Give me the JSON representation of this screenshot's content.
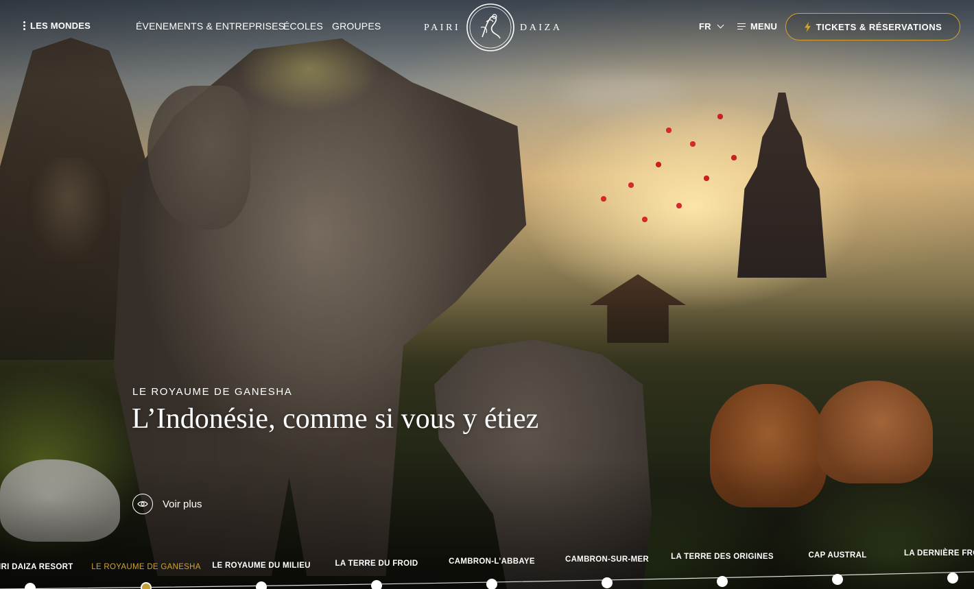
{
  "header": {
    "mondes_label": "LES MONDES",
    "nav": [
      "ÉVENEMENTS & ENTREPRISES",
      "ÉCOLES",
      "GROUPES"
    ],
    "logo_left": "PAIRI",
    "logo_right": "DAIZA",
    "lang": "FR",
    "menu_label": "MENU",
    "tickets_label": "TICKETS & RÉSERVATIONS"
  },
  "hero": {
    "kicker": "LE ROYAUME DE GANESHA",
    "headline": "L’Indonésie, comme si vous y étiez",
    "cta_label": "Voir plus"
  },
  "timeline": {
    "items": [
      {
        "label": "IRI DAIZA RESORT",
        "active": false
      },
      {
        "label": "LE ROYAUME DE GANESHA",
        "active": true
      },
      {
        "label": "LE ROYAUME DU MILIEU",
        "active": false
      },
      {
        "label": "LA TERRE DU FROID",
        "active": false
      },
      {
        "label": "CAMBRON-L’ABBAYE",
        "active": false
      },
      {
        "label": "CAMBRON-SUR-MER",
        "active": false
      },
      {
        "label": "LA TERRE DES ORIGINES",
        "active": false
      },
      {
        "label": "CAP AUSTRAL",
        "active": false
      },
      {
        "label": "LA DERNIÈRE FRO",
        "active": false
      }
    ]
  },
  "colors": {
    "accent_gold": "#d4a329",
    "text": "#ffffff"
  },
  "icons": [
    "dots-vertical-icon",
    "chevron-down-icon",
    "hamburger-icon",
    "bolt-icon",
    "eye-icon"
  ]
}
